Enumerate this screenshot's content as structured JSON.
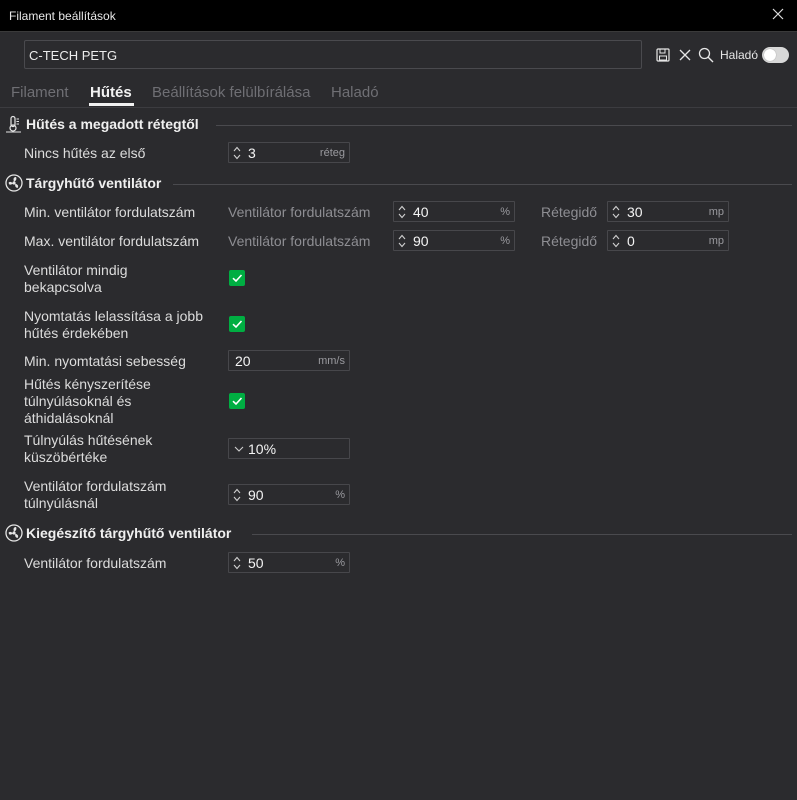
{
  "window": {
    "title": "Filament beállítások"
  },
  "preset": {
    "name": "C-TECH PETG"
  },
  "toolbar": {
    "advanced_label": "Haladó",
    "advanced_on": true
  },
  "tabs": [
    {
      "label": "Filament",
      "active": false
    },
    {
      "label": "Hűtés",
      "active": true
    },
    {
      "label": "Beállítások felülbírálása",
      "active": false
    },
    {
      "label": "Haladó",
      "active": false
    }
  ],
  "sections": {
    "cooling_layer": {
      "title": "Hűtés a megadott rétegtől",
      "no_cooling": {
        "label": "Nincs hűtés az első",
        "value": "3",
        "unit": "réteg"
      }
    },
    "part_fan": {
      "title": "Tárgyhűtő ventilátor",
      "min_fan": {
        "label": "Min. ventilátor fordulatszám",
        "speed_label": "Ventilátor fordulatszám",
        "speed_value": "40",
        "speed_unit": "%",
        "time_label": "Rétegidő",
        "time_value": "30",
        "time_unit": "mp"
      },
      "max_fan": {
        "label": "Max. ventilátor fordulatszám",
        "speed_label": "Ventilátor fordulatszám",
        "speed_value": "90",
        "speed_unit": "%",
        "time_label": "Rétegidő",
        "time_value": "0",
        "time_unit": "mp"
      },
      "always_on": {
        "label_line1": "Ventilátor mindig",
        "label_line2": "bekapcsolva",
        "checked": true
      },
      "slow_down": {
        "label_line1": "Nyomtatás lelassítása a jobb",
        "label_line2": "hűtés érdekében",
        "checked": true
      },
      "min_print_speed": {
        "label": "Min. nyomtatási sebesség",
        "value": "20",
        "unit": "mm/s"
      },
      "force_cooling": {
        "label_line1": "Hűtés kényszerítése",
        "label_line2": "túlnyúlásoknál és",
        "label_line3": "áthidalásoknál",
        "checked": true
      },
      "overhang_threshold": {
        "label_line1": "Túlnyúlás hűtésének",
        "label_line2": "küszöbértéke",
        "value": "10%"
      },
      "overhang_fan": {
        "label_line1": "Ventilátor fordulatszám",
        "label_line2": "túlnyúlásnál",
        "value": "90",
        "unit": "%"
      }
    },
    "aux_fan": {
      "title": "Kiegészítő tárgyhűtő ventilátor",
      "fan_speed": {
        "label": "Ventilátor fordulatszám",
        "value": "50",
        "unit": "%"
      }
    }
  },
  "colors": {
    "accent": "#00ae42",
    "background": "#2b2b2e",
    "titlebar": "#000000"
  }
}
